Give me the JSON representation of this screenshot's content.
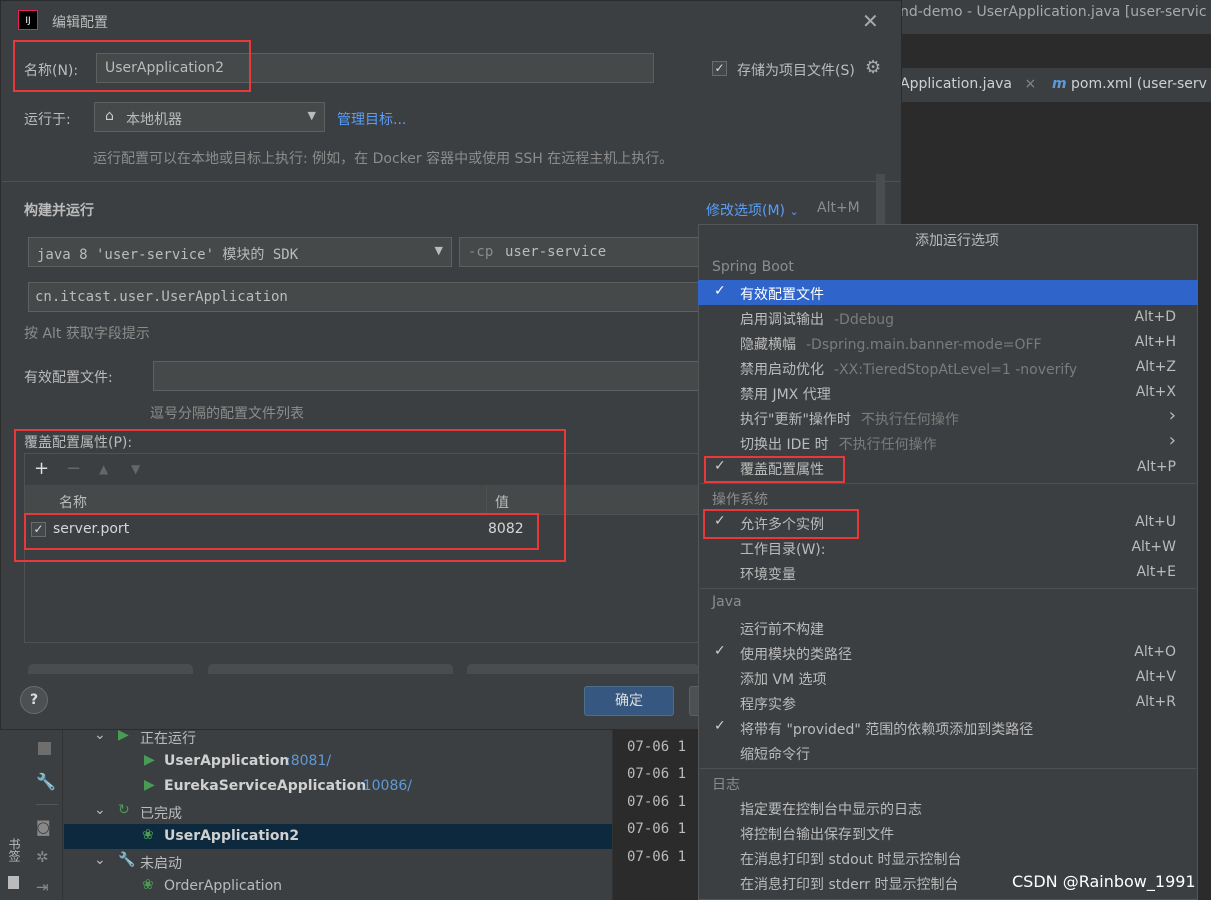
{
  "ide": {
    "title": "nd-demo - UserApplication.java [user-servic",
    "tab_java": "Application.java",
    "tab_pom": "pom.xml (user-serv",
    "run_tree": [
      {
        "label": "正在运行",
        "kind": "group"
      },
      {
        "label": "UserApplication",
        "port": ":8081/",
        "kind": "running"
      },
      {
        "label": "EurekaServiceApplication",
        "port": ":10086/",
        "kind": "running"
      },
      {
        "label": "已完成",
        "kind": "group"
      },
      {
        "label": "UserApplication2",
        "port": "",
        "kind": "done"
      },
      {
        "label": "未启动",
        "kind": "group"
      },
      {
        "label": "OrderApplication",
        "port": "",
        "kind": "notstarted"
      }
    ],
    "console_lines": [
      "07-06 1",
      "07-06 1",
      "07-06 1",
      "07-06 1",
      "07-06 1"
    ],
    "bookmarks_label": "书签"
  },
  "dialog": {
    "title": "编辑配置",
    "name_label": "名称(N):",
    "name_value": "UserApplication2",
    "store_as_file": "存储为项目文件(S)",
    "run_on_label": "运行于:",
    "run_on_value": "本地机器",
    "manage_targets": "管理目标...",
    "run_on_hint": "运行配置可以在本地或目标上执行: 例如，在 Docker 容器中或使用 SSH 在远程主机上执行。",
    "build_run": "构建并运行",
    "modify_options": "修改选项(M)",
    "modify_shortcut": "Alt+M",
    "sdk_value": "java 8 'user-service' 模块的 SDK",
    "cp_prefix": "-cp",
    "cp_value": "user-service",
    "main_class": "cn.itcast.user.UserApplication",
    "alt_hint": "按 Alt 获取字段提示",
    "profiles_label": "有效配置文件:",
    "profiles_hint": "逗号分隔的配置文件列表",
    "override_label": "覆盖配置属性(P):",
    "table_headers": [
      "名称",
      "值"
    ],
    "properties": [
      {
        "name": "server.port",
        "value": "8082",
        "checked": true
      }
    ],
    "ok_label": "确定"
  },
  "popup": {
    "title": "添加运行选项",
    "sections": [
      {
        "header": "Spring Boot",
        "items": [
          {
            "label": "有效配置文件",
            "sub": "",
            "shortcut": "",
            "checked": true,
            "selected": true,
            "arrow": false
          },
          {
            "label": "启用调试输出",
            "sub": "-Ddebug",
            "shortcut": "Alt+D",
            "checked": false,
            "selected": false,
            "arrow": false
          },
          {
            "label": "隐藏横幅",
            "sub": "-Dspring.main.banner-mode=OFF",
            "shortcut": "Alt+H",
            "checked": false,
            "selected": false,
            "arrow": false
          },
          {
            "label": "禁用启动优化",
            "sub": "-XX:TieredStopAtLevel=1 -noverify",
            "shortcut": "Alt+Z",
            "checked": false,
            "selected": false,
            "arrow": false
          },
          {
            "label": "禁用 JMX 代理",
            "sub": "",
            "shortcut": "Alt+X",
            "checked": false,
            "selected": false,
            "arrow": false
          },
          {
            "label": "执行\"更新\"操作时",
            "sub": "不执行任何操作",
            "shortcut": "",
            "checked": false,
            "selected": false,
            "arrow": true
          },
          {
            "label": "切换出 IDE 时",
            "sub": "不执行任何操作",
            "shortcut": "",
            "checked": false,
            "selected": false,
            "arrow": true
          },
          {
            "label": "覆盖配置属性",
            "sub": "",
            "shortcut": "Alt+P",
            "checked": true,
            "selected": false,
            "arrow": false
          }
        ]
      },
      {
        "header": "操作系统",
        "items": [
          {
            "label": "允许多个实例",
            "sub": "",
            "shortcut": "Alt+U",
            "checked": true,
            "selected": false,
            "arrow": false
          },
          {
            "label": "工作目录(W):",
            "sub": "",
            "shortcut": "Alt+W",
            "checked": false,
            "selected": false,
            "arrow": false
          },
          {
            "label": "环境变量",
            "sub": "",
            "shortcut": "Alt+E",
            "checked": false,
            "selected": false,
            "arrow": false
          }
        ]
      },
      {
        "header": "Java",
        "items": [
          {
            "label": "运行前不构建",
            "sub": "",
            "shortcut": "",
            "checked": false,
            "selected": false,
            "arrow": false
          },
          {
            "label": "使用模块的类路径",
            "sub": "",
            "shortcut": "Alt+O",
            "checked": true,
            "selected": false,
            "arrow": false
          },
          {
            "label": "添加 VM 选项",
            "sub": "",
            "shortcut": "Alt+V",
            "checked": false,
            "selected": false,
            "arrow": false
          },
          {
            "label": "程序实参",
            "sub": "",
            "shortcut": "Alt+R",
            "checked": false,
            "selected": false,
            "arrow": false
          },
          {
            "label": "将带有 \"provided\" 范围的依赖项添加到类路径",
            "sub": "",
            "shortcut": "",
            "checked": true,
            "selected": false,
            "arrow": false
          },
          {
            "label": "缩短命令行",
            "sub": "",
            "shortcut": "",
            "checked": false,
            "selected": false,
            "arrow": false
          }
        ]
      },
      {
        "header": "日志",
        "items": [
          {
            "label": "指定要在控制台中显示的日志",
            "sub": "",
            "shortcut": "",
            "checked": false,
            "selected": false,
            "arrow": false
          },
          {
            "label": "将控制台输出保存到文件",
            "sub": "",
            "shortcut": "",
            "checked": false,
            "selected": false,
            "arrow": false
          },
          {
            "label": "在消息打印到 stdout 时显示控制台",
            "sub": "",
            "shortcut": "",
            "checked": false,
            "selected": false,
            "arrow": false
          },
          {
            "label": "在消息打印到 stderr 时显示控制台",
            "sub": "",
            "shortcut": "",
            "checked": false,
            "selected": false,
            "arrow": false
          }
        ]
      }
    ]
  },
  "watermark": "CSDN @Rainbow_1991",
  "colors": {
    "highlight_box": "#e8393a",
    "selection": "#2f65ca",
    "link": "#589df6",
    "primary_button": "#365880"
  }
}
